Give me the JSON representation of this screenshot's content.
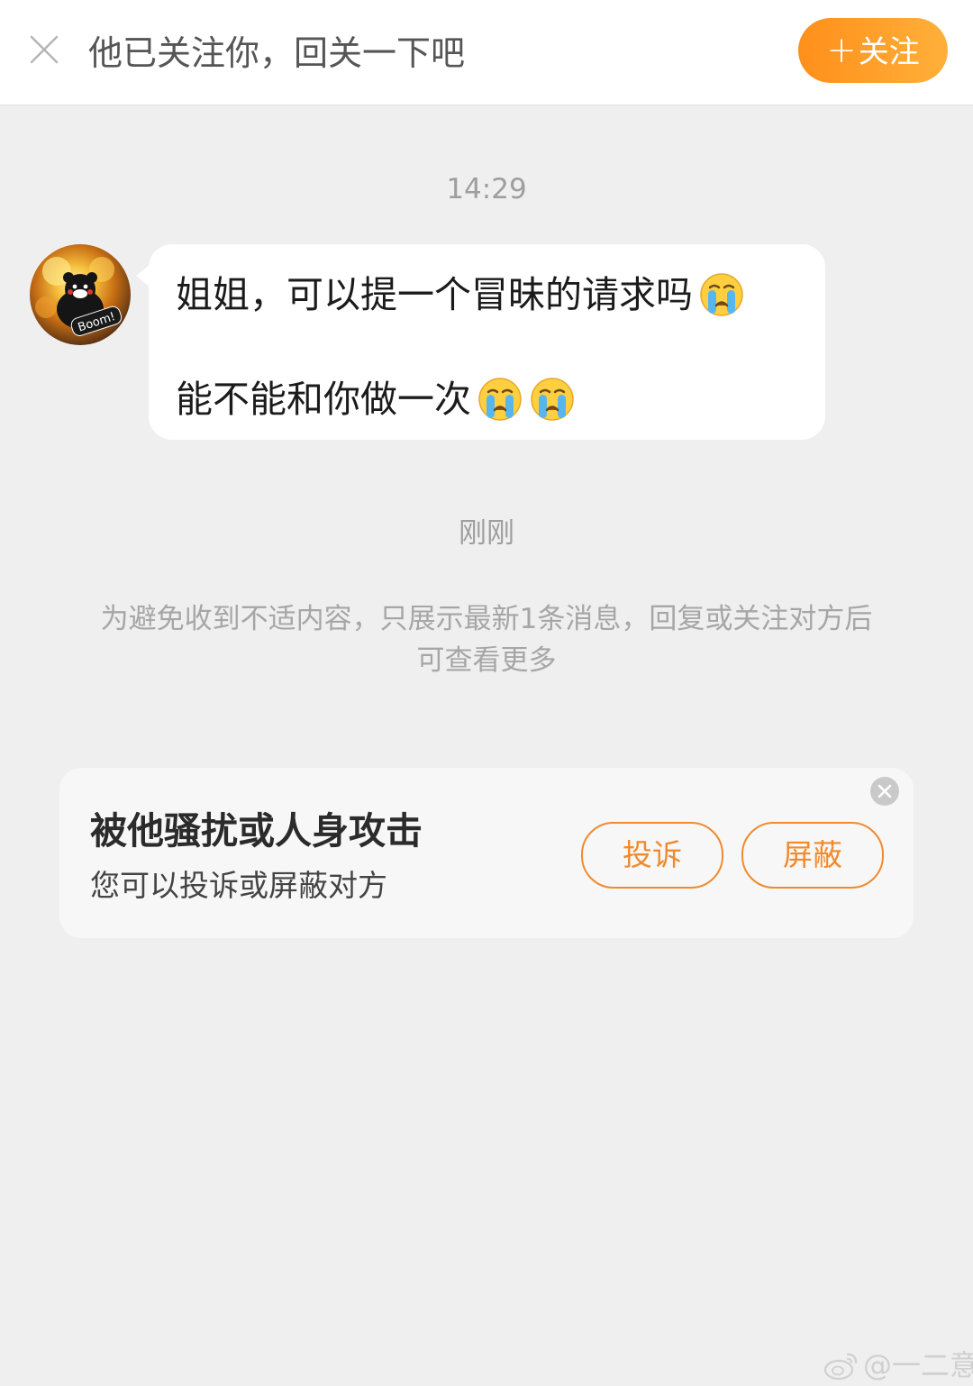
{
  "topbar": {
    "text": "他已关注你，回关一下吧",
    "follow_label": "关注",
    "follow_plus": "+",
    "accent": "#ff9a20"
  },
  "chat": {
    "timestamp_1": "14:29",
    "message": {
      "line1": "姐姐，可以提一个冒昧的请求吗",
      "line1_emojis": [
        "crying-face"
      ],
      "line2": "能不能和你做一次",
      "line2_emojis": [
        "crying-face",
        "crying-face"
      ]
    },
    "timestamp_2": "刚刚",
    "notice": "为避免收到不适内容，只展示最新1条消息，回复或关注对方后可查看更多"
  },
  "report_card": {
    "title": "被他骚扰或人身攻击",
    "subtitle": "您可以投诉或屏蔽对方",
    "report_label": "投诉",
    "block_label": "屏蔽",
    "accent": "#f08a2e"
  },
  "avatar": {
    "badge_text": "Boom!"
  },
  "watermark": {
    "text": "@一二意"
  }
}
